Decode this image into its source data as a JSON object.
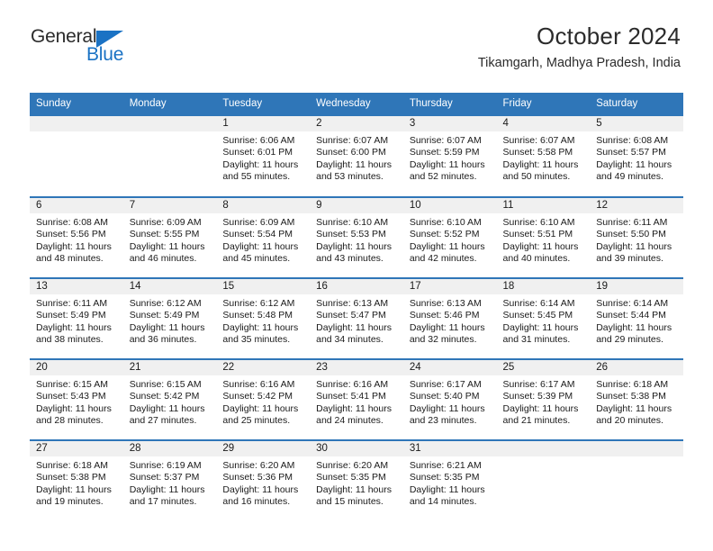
{
  "brand": {
    "name_top": "General",
    "name_bottom": "Blue",
    "accent_color": "#1a72c4"
  },
  "header": {
    "title": "October 2024",
    "subtitle": "Tikamgarh, Madhya Pradesh, India"
  },
  "calendar": {
    "header_bg": "#2f76b8",
    "daynum_bg": "#f0f0f0",
    "weekdays": [
      "Sunday",
      "Monday",
      "Tuesday",
      "Wednesday",
      "Thursday",
      "Friday",
      "Saturday"
    ],
    "weeks": [
      [
        {
          "day": ""
        },
        {
          "day": ""
        },
        {
          "day": "1",
          "sunrise": "Sunrise: 6:06 AM",
          "sunset": "Sunset: 6:01 PM",
          "daylight_1": "Daylight: 11 hours",
          "daylight_2": "and 55 minutes."
        },
        {
          "day": "2",
          "sunrise": "Sunrise: 6:07 AM",
          "sunset": "Sunset: 6:00 PM",
          "daylight_1": "Daylight: 11 hours",
          "daylight_2": "and 53 minutes."
        },
        {
          "day": "3",
          "sunrise": "Sunrise: 6:07 AM",
          "sunset": "Sunset: 5:59 PM",
          "daylight_1": "Daylight: 11 hours",
          "daylight_2": "and 52 minutes."
        },
        {
          "day": "4",
          "sunrise": "Sunrise: 6:07 AM",
          "sunset": "Sunset: 5:58 PM",
          "daylight_1": "Daylight: 11 hours",
          "daylight_2": "and 50 minutes."
        },
        {
          "day": "5",
          "sunrise": "Sunrise: 6:08 AM",
          "sunset": "Sunset: 5:57 PM",
          "daylight_1": "Daylight: 11 hours",
          "daylight_2": "and 49 minutes."
        }
      ],
      [
        {
          "day": "6",
          "sunrise": "Sunrise: 6:08 AM",
          "sunset": "Sunset: 5:56 PM",
          "daylight_1": "Daylight: 11 hours",
          "daylight_2": "and 48 minutes."
        },
        {
          "day": "7",
          "sunrise": "Sunrise: 6:09 AM",
          "sunset": "Sunset: 5:55 PM",
          "daylight_1": "Daylight: 11 hours",
          "daylight_2": "and 46 minutes."
        },
        {
          "day": "8",
          "sunrise": "Sunrise: 6:09 AM",
          "sunset": "Sunset: 5:54 PM",
          "daylight_1": "Daylight: 11 hours",
          "daylight_2": "and 45 minutes."
        },
        {
          "day": "9",
          "sunrise": "Sunrise: 6:10 AM",
          "sunset": "Sunset: 5:53 PM",
          "daylight_1": "Daylight: 11 hours",
          "daylight_2": "and 43 minutes."
        },
        {
          "day": "10",
          "sunrise": "Sunrise: 6:10 AM",
          "sunset": "Sunset: 5:52 PM",
          "daylight_1": "Daylight: 11 hours",
          "daylight_2": "and 42 minutes."
        },
        {
          "day": "11",
          "sunrise": "Sunrise: 6:10 AM",
          "sunset": "Sunset: 5:51 PM",
          "daylight_1": "Daylight: 11 hours",
          "daylight_2": "and 40 minutes."
        },
        {
          "day": "12",
          "sunrise": "Sunrise: 6:11 AM",
          "sunset": "Sunset: 5:50 PM",
          "daylight_1": "Daylight: 11 hours",
          "daylight_2": "and 39 minutes."
        }
      ],
      [
        {
          "day": "13",
          "sunrise": "Sunrise: 6:11 AM",
          "sunset": "Sunset: 5:49 PM",
          "daylight_1": "Daylight: 11 hours",
          "daylight_2": "and 38 minutes."
        },
        {
          "day": "14",
          "sunrise": "Sunrise: 6:12 AM",
          "sunset": "Sunset: 5:49 PM",
          "daylight_1": "Daylight: 11 hours",
          "daylight_2": "and 36 minutes."
        },
        {
          "day": "15",
          "sunrise": "Sunrise: 6:12 AM",
          "sunset": "Sunset: 5:48 PM",
          "daylight_1": "Daylight: 11 hours",
          "daylight_2": "and 35 minutes."
        },
        {
          "day": "16",
          "sunrise": "Sunrise: 6:13 AM",
          "sunset": "Sunset: 5:47 PM",
          "daylight_1": "Daylight: 11 hours",
          "daylight_2": "and 34 minutes."
        },
        {
          "day": "17",
          "sunrise": "Sunrise: 6:13 AM",
          "sunset": "Sunset: 5:46 PM",
          "daylight_1": "Daylight: 11 hours",
          "daylight_2": "and 32 minutes."
        },
        {
          "day": "18",
          "sunrise": "Sunrise: 6:14 AM",
          "sunset": "Sunset: 5:45 PM",
          "daylight_1": "Daylight: 11 hours",
          "daylight_2": "and 31 minutes."
        },
        {
          "day": "19",
          "sunrise": "Sunrise: 6:14 AM",
          "sunset": "Sunset: 5:44 PM",
          "daylight_1": "Daylight: 11 hours",
          "daylight_2": "and 29 minutes."
        }
      ],
      [
        {
          "day": "20",
          "sunrise": "Sunrise: 6:15 AM",
          "sunset": "Sunset: 5:43 PM",
          "daylight_1": "Daylight: 11 hours",
          "daylight_2": "and 28 minutes."
        },
        {
          "day": "21",
          "sunrise": "Sunrise: 6:15 AM",
          "sunset": "Sunset: 5:42 PM",
          "daylight_1": "Daylight: 11 hours",
          "daylight_2": "and 27 minutes."
        },
        {
          "day": "22",
          "sunrise": "Sunrise: 6:16 AM",
          "sunset": "Sunset: 5:42 PM",
          "daylight_1": "Daylight: 11 hours",
          "daylight_2": "and 25 minutes."
        },
        {
          "day": "23",
          "sunrise": "Sunrise: 6:16 AM",
          "sunset": "Sunset: 5:41 PM",
          "daylight_1": "Daylight: 11 hours",
          "daylight_2": "and 24 minutes."
        },
        {
          "day": "24",
          "sunrise": "Sunrise: 6:17 AM",
          "sunset": "Sunset: 5:40 PM",
          "daylight_1": "Daylight: 11 hours",
          "daylight_2": "and 23 minutes."
        },
        {
          "day": "25",
          "sunrise": "Sunrise: 6:17 AM",
          "sunset": "Sunset: 5:39 PM",
          "daylight_1": "Daylight: 11 hours",
          "daylight_2": "and 21 minutes."
        },
        {
          "day": "26",
          "sunrise": "Sunrise: 6:18 AM",
          "sunset": "Sunset: 5:38 PM",
          "daylight_1": "Daylight: 11 hours",
          "daylight_2": "and 20 minutes."
        }
      ],
      [
        {
          "day": "27",
          "sunrise": "Sunrise: 6:18 AM",
          "sunset": "Sunset: 5:38 PM",
          "daylight_1": "Daylight: 11 hours",
          "daylight_2": "and 19 minutes."
        },
        {
          "day": "28",
          "sunrise": "Sunrise: 6:19 AM",
          "sunset": "Sunset: 5:37 PM",
          "daylight_1": "Daylight: 11 hours",
          "daylight_2": "and 17 minutes."
        },
        {
          "day": "29",
          "sunrise": "Sunrise: 6:20 AM",
          "sunset": "Sunset: 5:36 PM",
          "daylight_1": "Daylight: 11 hours",
          "daylight_2": "and 16 minutes."
        },
        {
          "day": "30",
          "sunrise": "Sunrise: 6:20 AM",
          "sunset": "Sunset: 5:35 PM",
          "daylight_1": "Daylight: 11 hours",
          "daylight_2": "and 15 minutes."
        },
        {
          "day": "31",
          "sunrise": "Sunrise: 6:21 AM",
          "sunset": "Sunset: 5:35 PM",
          "daylight_1": "Daylight: 11 hours",
          "daylight_2": "and 14 minutes."
        },
        {
          "day": ""
        },
        {
          "day": ""
        }
      ]
    ]
  }
}
